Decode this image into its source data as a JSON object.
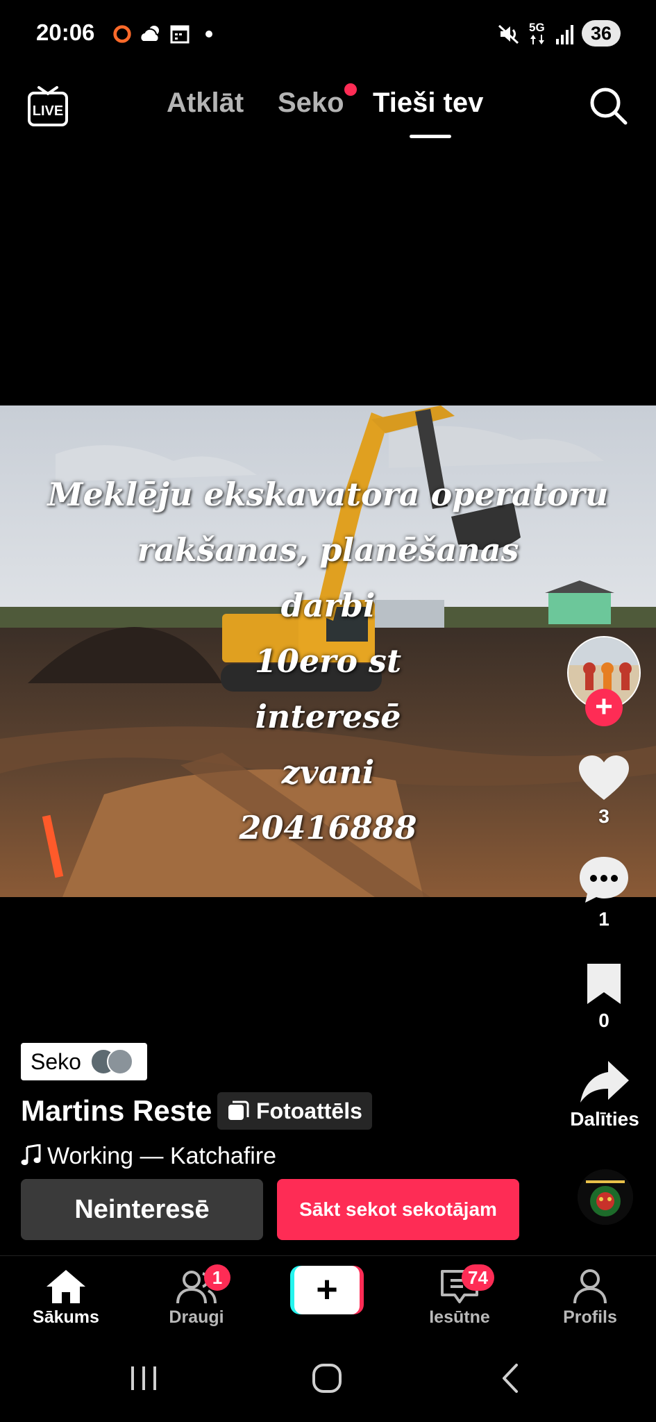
{
  "status_bar": {
    "time": "20:06",
    "battery": "36",
    "icons": [
      "record-icon",
      "weather-icon",
      "calendar-icon",
      "dot-icon",
      "mute-icon",
      "5g-icon",
      "signal-icon"
    ]
  },
  "top_nav": {
    "live_label": "LIVE",
    "tabs": [
      {
        "label": "Atklāt",
        "active": false
      },
      {
        "label": "Seko",
        "active": false,
        "has_dot": true
      },
      {
        "label": "Tieši tev",
        "active": true
      }
    ]
  },
  "post": {
    "overlay_lines": [
      "Meklēju ekskavatora operatoru",
      "rakšanas, planēšanas",
      "darbi",
      "10ero st",
      "interesē",
      "zvani",
      "20416888"
    ],
    "follow_label": "Seko",
    "author": "Martins Reste",
    "type_badge": "Fotoattēls",
    "music": "Working — Katchafire"
  },
  "rail": {
    "likes": "3",
    "comments": "1",
    "saves": "0",
    "share_label": "Dalīties"
  },
  "actions": {
    "not_interested": "Neinteresē",
    "follow_back": "Sākt sekot sekotājam"
  },
  "bottom_nav": {
    "home": "Sākums",
    "friends": "Draugi",
    "friends_badge": "1",
    "inbox": "Iesūtne",
    "inbox_badge": "74",
    "profile": "Profils"
  },
  "colors": {
    "accent": "#fe2c55",
    "cyan": "#25f4ee",
    "background": "#000000"
  }
}
